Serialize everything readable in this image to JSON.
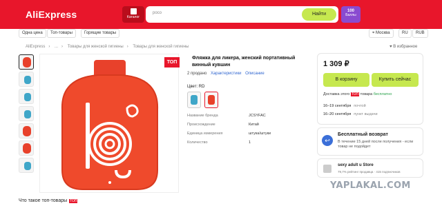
{
  "header": {
    "logo": "AliExpress",
    "catalog_label": "Каталог",
    "search_value": "poco",
    "search_button": "Найти",
    "points_value": "100",
    "points_label": "Баллы"
  },
  "quicklinks": [
    "Одна цена",
    "Топ-товары",
    "Горящие товары"
  ],
  "region": {
    "city": "Москва",
    "lang": "RU",
    "currency": "RUB"
  },
  "breadcrumbs": [
    "AliExpress",
    "...",
    "Товары для женской гигиены",
    "Товары для женской гигиены"
  ],
  "favorites_label": "В избранное",
  "product": {
    "top_badge": "ТОП",
    "title": "Фляжка для ликера, женский портативный винный кувшин",
    "sold": "2 продано",
    "tab_characteristics": "Характеристики",
    "tab_description": "Описание",
    "color_label": "Цвет: RD",
    "specs": [
      {
        "name": "Название бренда",
        "value": "JCSYFAC"
      },
      {
        "name": "Происхождение",
        "value": "Китай"
      },
      {
        "name": "Единица измерения",
        "value": "штука/штуки"
      },
      {
        "name": "Количество",
        "value": "1"
      }
    ]
  },
  "buybox": {
    "price": "1 309 ₽",
    "cart_button": "В корзину",
    "buy_button": "Купить сейчас",
    "delivery_prefix": "Доставка этого",
    "delivery_top": "ТОП",
    "delivery_suffix": "товара",
    "delivery_free": "бесплатно",
    "options": [
      {
        "dates": "16–19 сентября",
        "method": "почтой"
      },
      {
        "dates": "16–20 сентября",
        "method": "пункт выдачи"
      }
    ]
  },
  "return_card": {
    "title": "Бесплатный возврат",
    "text": "В течение 15 дней после получения - если товар не подойдет"
  },
  "store": {
    "name": "sexy adult u Store",
    "stats": "79,7% рейтинг продавца · 415 подписчиков"
  },
  "watermark": "YAPLAKAL.COM",
  "bottom_heading": "Что такое топ-товары",
  "bottom_badge": "ТОП",
  "colors": {
    "brand": "#e8162b",
    "accent": "#c6e84f",
    "link": "#3066d0"
  }
}
